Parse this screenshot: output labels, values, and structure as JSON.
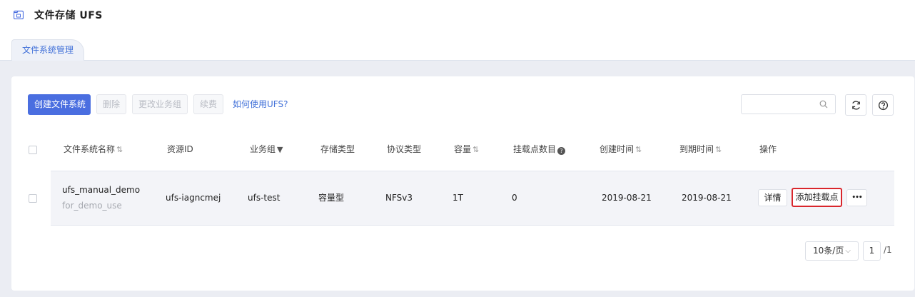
{
  "header": {
    "title": "文件存储 UFS"
  },
  "tabs": [
    {
      "label": "文件系统管理"
    }
  ],
  "toolbar": {
    "create_label": "创建文件系统",
    "delete_label": "删除",
    "change_group_label": "更改业务组",
    "renew_label": "续费",
    "help_link": "如何使用UFS?",
    "search": {
      "value": "",
      "placeholder": ""
    }
  },
  "table": {
    "columns": [
      "文件系统名称",
      "资源ID",
      "业务组",
      "存储类型",
      "协议类型",
      "容量",
      "挂载点数目",
      "创建时间",
      "到期时间",
      "操作"
    ],
    "rows": [
      {
        "name": "ufs_manual_demo",
        "remark": "for_demo_use",
        "resource_id": "ufs-iagncmej",
        "group": "ufs-test",
        "storage_type": "容量型",
        "protocol": "NFSv3",
        "capacity": "1T",
        "mount_count": "0",
        "created": "2019-08-21",
        "expires": "2019-08-21",
        "actions": {
          "detail": "详情",
          "add_mount": "添加挂载点",
          "more": "•••"
        }
      }
    ]
  },
  "pagination": {
    "page_size": "10条/页",
    "current_page": "1",
    "total": "/1"
  },
  "colors": {
    "primary": "#4a6ee0",
    "highlight": "#d9262c",
    "link": "#3f6fd8"
  }
}
